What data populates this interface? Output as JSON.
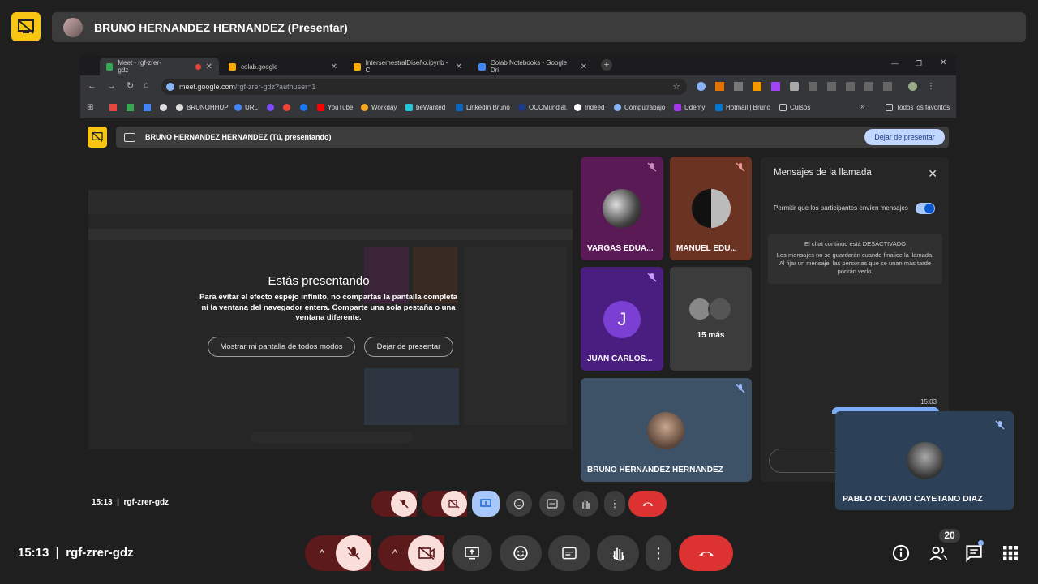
{
  "outer": {
    "title": "BRUNO HERNANDEZ HERNANDEZ (Presentar)",
    "time": "15:13",
    "separator": "|",
    "meeting_code": "rgf-zrer-gdz",
    "participants_count": "20"
  },
  "browser": {
    "tabs": [
      {
        "label": "Meet - rgf-zrer-gdz",
        "color": "#34a853"
      },
      {
        "label": "colab.google",
        "color": "#f9ab00"
      },
      {
        "label": "IntersemestralDiseño.ipynb - C",
        "color": "#f9ab00"
      },
      {
        "label": "Colab Notebooks - Google Dri",
        "color": "#4285f4"
      }
    ],
    "url_main": "meet.google.com",
    "url_path": "/rgf-zrer-gdz?authuser=1",
    "bookmarks": [
      "BRUNOHHUP",
      "URL",
      "YouTube",
      "Workday",
      "beWanted",
      "LinkedIn Bruno",
      "OCCMundial.",
      "Indeed",
      "Computrabajo",
      "Udemy",
      "Hotmail | Bruno",
      "Cursos"
    ],
    "bookmarks_all": "Todos los favoritos",
    "more": "»"
  },
  "inner": {
    "bar_title": "BRUNO HERNANDEZ HERNANDEZ (Tú, presentando)",
    "stop_presenting": "Dejar de presentar",
    "time": "15:13",
    "meeting_code": "rgf-zrer-gdz"
  },
  "dialog": {
    "title": "Estás presentando",
    "message": "Para evitar el efecto espejo infinito, no compartas la pantalla completa ni la ventana del navegador entera. Comparte una sola pestaña o una ventana diferente.",
    "show_anyway": "Mostrar mi pantalla de todos modos",
    "stop": "Dejar de presentar"
  },
  "tiles": [
    {
      "name": "VARGAS EDUA...",
      "bg": "#5a1a55"
    },
    {
      "name": "MANUEL EDU...",
      "bg": "#6a3322"
    },
    {
      "name": "JUAN CARLOS...",
      "bg": "#4a1e80",
      "initial": "J"
    },
    {
      "name": "15 más",
      "bg": "#3c3c3c"
    },
    {
      "name": "BRUNO HERNANDEZ HERNANDEZ",
      "bg": "#3d5167"
    },
    {
      "name": "PABLO OCTAVIO CAYETANO DIAZ",
      "bg": "#2c4158"
    }
  ],
  "chat": {
    "title": "Mensajes de la llamada",
    "close": "✕",
    "toggle_label": "Permitir que los participantes envíen mensajes",
    "info_title": "El chat continuo está DESACTIVADO",
    "info_body": "Los mensajes no se guardarán cuando finalice la llamada. Al fijar un mensaje, las personas que se unan más tarde podrán verlo.",
    "timestamp": "15:03"
  },
  "colors": {
    "present_yellow": "#f9c513",
    "hangup_red": "#dc3232",
    "muted_red": "#5c1a1a",
    "muted_pink": "#f9dedc",
    "present_blue": "#a8c7fa"
  }
}
